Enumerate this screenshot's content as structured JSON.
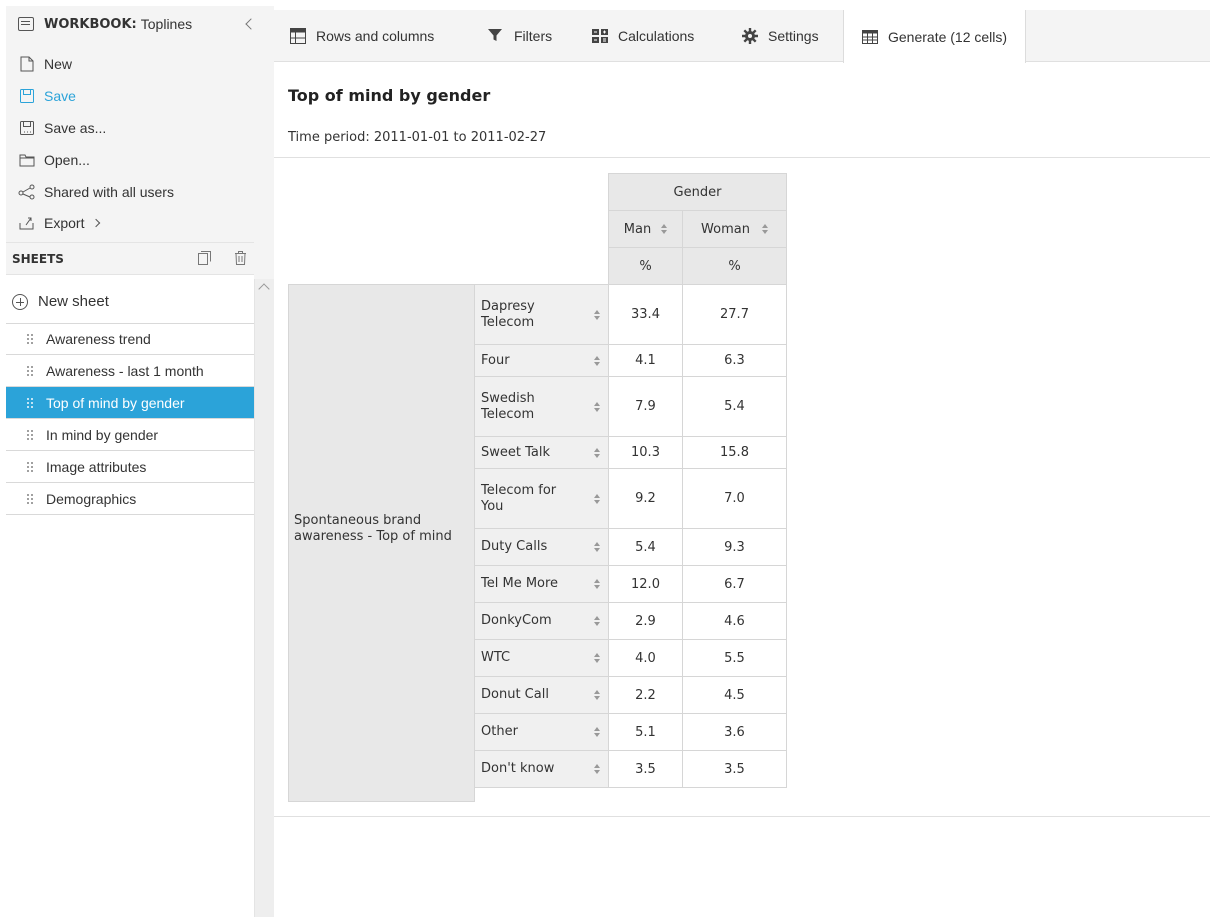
{
  "sidebar": {
    "workbook_label": "WORKBOOK:",
    "workbook_name": "Toplines",
    "menu": [
      {
        "label": "New"
      },
      {
        "label": "Save"
      },
      {
        "label": "Save as..."
      },
      {
        "label": "Open..."
      },
      {
        "label": "Shared with all users"
      },
      {
        "label": "Export"
      }
    ],
    "sheets_title": "SHEETS",
    "new_sheet": "New sheet",
    "sheets": [
      {
        "label": "Awareness trend"
      },
      {
        "label": "Awareness - last 1 month"
      },
      {
        "label": "Top of mind by gender"
      },
      {
        "label": "In mind by gender"
      },
      {
        "label": "Image attributes"
      },
      {
        "label": "Demographics"
      }
    ]
  },
  "tabs": [
    {
      "label": "Rows and columns"
    },
    {
      "label": "Filters"
    },
    {
      "label": "Calculations"
    },
    {
      "label": "Settings"
    },
    {
      "label": "Generate (12 cells)"
    }
  ],
  "main": {
    "title": "Top of mind by gender",
    "time_period": "Time period: 2011-01-01 to 2011-02-27"
  },
  "table": {
    "column_group": "Gender",
    "columns": [
      "Man",
      "Woman"
    ],
    "unit": "%",
    "row_group": "Spontaneous brand awareness - Top of mind",
    "rows": [
      {
        "label": "Dapresy Telecom",
        "values": [
          "33.4",
          "27.7"
        ]
      },
      {
        "label": "Four",
        "values": [
          "4.1",
          "6.3"
        ]
      },
      {
        "label": "Swedish Telecom",
        "values": [
          "7.9",
          "5.4"
        ]
      },
      {
        "label": "Sweet Talk",
        "values": [
          "10.3",
          "15.8"
        ]
      },
      {
        "label": "Telecom for You",
        "values": [
          "9.2",
          "7.0"
        ]
      },
      {
        "label": "Duty Calls",
        "values": [
          "5.4",
          "9.3"
        ]
      },
      {
        "label": "Tel Me More",
        "values": [
          "12.0",
          "6.7"
        ]
      },
      {
        "label": "DonkyCom",
        "values": [
          "2.9",
          "4.6"
        ]
      },
      {
        "label": "WTC",
        "values": [
          "4.0",
          "5.5"
        ]
      },
      {
        "label": "Donut Call",
        "values": [
          "2.2",
          "4.5"
        ]
      },
      {
        "label": "Other",
        "values": [
          "5.1",
          "3.6"
        ]
      },
      {
        "label": "Don't know",
        "values": [
          "3.5",
          "3.5"
        ]
      }
    ]
  },
  "colors": {
    "accent": "#2ba3d9",
    "header_bg": "#e8e8e8"
  }
}
